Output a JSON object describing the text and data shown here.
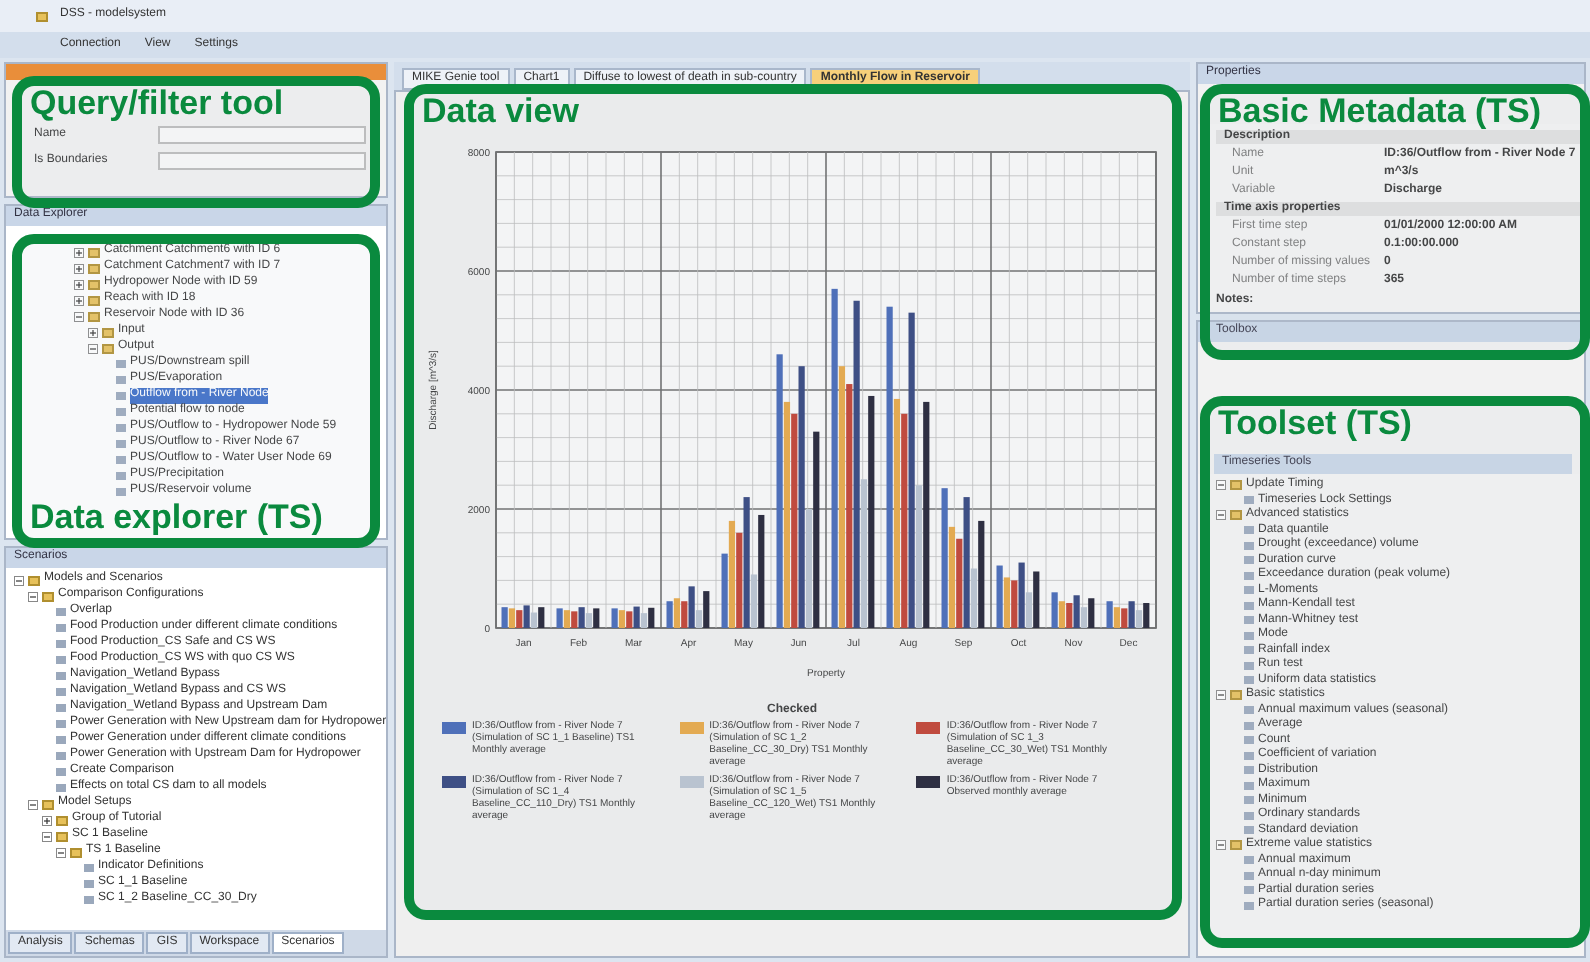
{
  "window": {
    "title": "DSS - modelsystem"
  },
  "menu": [
    "Connection",
    "View",
    "Settings"
  ],
  "query": {
    "fields": [
      {
        "label": "Name"
      },
      {
        "label": "Is Boundaries"
      }
    ]
  },
  "explorer": {
    "header": "Data Explorer",
    "tree": [
      {
        "label": "Catchment Catchment6 with ID 6",
        "expanded": false
      },
      {
        "label": "Catchment Catchment7 with ID 7",
        "expanded": false
      },
      {
        "label": "Hydropower Node with ID 59",
        "expanded": false
      },
      {
        "label": "Reach with ID 18",
        "expanded": false
      },
      {
        "label": "Reservoir Node with ID 36",
        "expanded": true,
        "children": [
          {
            "label": "Input",
            "expanded": false
          },
          {
            "label": "Output",
            "expanded": true,
            "children": [
              {
                "label": "PUS/Downstream spill",
                "selected": false
              },
              {
                "label": "PUS/Evaporation",
                "selected": false
              },
              {
                "label": "Outflow from - River Node",
                "selected": true
              },
              {
                "label": "Potential flow to node",
                "selected": false
              },
              {
                "label": "PUS/Outflow to - Hydropower Node 59",
                "selected": false
              },
              {
                "label": "PUS/Outflow to - River Node 67",
                "selected": false
              },
              {
                "label": "PUS/Outflow to - Water User Node 69",
                "selected": false
              },
              {
                "label": "PUS/Precipitation",
                "selected": false
              },
              {
                "label": "PUS/Reservoir volume",
                "selected": false
              }
            ]
          }
        ]
      }
    ]
  },
  "scenarios": {
    "header": "Scenarios",
    "tree": [
      {
        "label": "Models and Scenarios",
        "expanded": true,
        "children": [
          {
            "label": "Comparison Configurations",
            "expanded": true,
            "children": [
              {
                "label": "Overlap"
              },
              {
                "label": "Food Production under different climate conditions"
              },
              {
                "label": "Food Production_CS Safe and CS WS"
              },
              {
                "label": "Food Production_CS WS with quo CS WS"
              },
              {
                "label": "Navigation_Wetland Bypass"
              },
              {
                "label": "Navigation_Wetland Bypass and CS WS"
              },
              {
                "label": "Navigation_Wetland Bypass and Upstream Dam"
              },
              {
                "label": "Power Generation with New Upstream dam for Hydropower"
              },
              {
                "label": "Power Generation under different climate conditions"
              },
              {
                "label": "Power Generation with Upstream Dam for Hydropower"
              },
              {
                "label": "Create Comparison"
              },
              {
                "label": "Effects on total CS dam to all models"
              }
            ]
          },
          {
            "label": "Model Setups",
            "expanded": true,
            "children": [
              {
                "label": "Group of Tutorial",
                "expanded": false
              },
              {
                "label": "SC 1 Baseline",
                "expanded": true,
                "children": [
                  {
                    "label": "TS 1 Baseline",
                    "expanded": true,
                    "children": [
                      {
                        "label": "Indicator Definitions"
                      },
                      {
                        "label": "SC 1_1 Baseline"
                      },
                      {
                        "label": "SC 1_2 Baseline_CC_30_Dry"
                      }
                    ]
                  }
                ]
              }
            ]
          }
        ]
      }
    ],
    "tabs": [
      {
        "label": "Analysis",
        "selected": false
      },
      {
        "label": "Schemas",
        "selected": false
      },
      {
        "label": "GIS",
        "selected": false
      },
      {
        "label": "Workspace",
        "selected": false
      },
      {
        "label": "Scenarios",
        "selected": true
      }
    ]
  },
  "documents": [
    {
      "label": "MIKE Genie tool",
      "selected": false
    },
    {
      "label": "Chart1",
      "selected": false
    },
    {
      "label": "Diffuse to lowest of death in sub-country",
      "selected": false
    },
    {
      "label": "Monthly Flow in Reservoir",
      "selected": true
    }
  ],
  "chart": {
    "legend_title": "Checked",
    "chart_data": {
      "type": "bar",
      "grid": true,
      "xlabel": "Property",
      "ylabel": "Discharge [m^3/s]",
      "categories": [
        "Jan",
        "Feb",
        "Mar",
        "Apr",
        "May",
        "Jun",
        "Jul",
        "Aug",
        "Sep",
        "Oct",
        "Nov",
        "Dec"
      ],
      "ylim": [
        0,
        8000
      ],
      "yticks": [
        0,
        2000,
        4000,
        6000,
        8000
      ],
      "series": [
        {
          "name": "ID:36/Outflow from - River Node 7 (Simulation of SC 1_1 Baseline) TS1 Monthly average",
          "color": "#3f63b5",
          "values": [
            350,
            330,
            330,
            450,
            1250,
            4600,
            5700,
            5400,
            2350,
            1050,
            600,
            450
          ]
        },
        {
          "name": "ID:36/Outflow from - River Node 7 (Simulation of SC 1_2 Baseline_CC_30_Dry) TS1 Monthly average",
          "color": "#e8a640",
          "values": [
            330,
            300,
            300,
            500,
            1800,
            3800,
            4400,
            3850,
            1700,
            850,
            450,
            350
          ]
        },
        {
          "name": "ID:36/Outflow from - River Node 7 (Simulation of SC 1_3 Baseline_CC_30_Wet) TS1 Monthly average",
          "color": "#c0392b",
          "values": [
            300,
            280,
            280,
            450,
            1600,
            3600,
            4100,
            3600,
            1500,
            800,
            420,
            330
          ]
        },
        {
          "name": "ID:36/Outflow from - River Node 7 (Simulation of SC 1_4 Baseline_CC_110_Dry) TS1 Monthly average",
          "color": "#2c3e7a",
          "values": [
            380,
            350,
            360,
            700,
            2200,
            4400,
            5500,
            5300,
            2200,
            1100,
            550,
            450
          ]
        },
        {
          "name": "ID:36/Outflow from - River Node 7 (Simulation of SC 1_5 Baseline_CC_120_Wet) TS1 Monthly average",
          "color": "#b8c2d0",
          "values": [
            260,
            250,
            250,
            300,
            900,
            2000,
            2500,
            2400,
            1000,
            600,
            350,
            300
          ]
        },
        {
          "name": "ID:36/Outflow from - River Node 7 Observed monthly average",
          "color": "#1a1a2e",
          "values": [
            350,
            330,
            340,
            620,
            1900,
            3300,
            3900,
            3800,
            1800,
            950,
            500,
            420
          ]
        }
      ]
    }
  },
  "properties": {
    "header": "Properties",
    "rows": [
      {
        "kind": "category",
        "name": "Description"
      },
      {
        "kind": "property",
        "name": "Name",
        "value": "ID:36/Outflow from - River Node 7"
      },
      {
        "kind": "property",
        "name": "Unit",
        "value": "m^3/s"
      },
      {
        "kind": "property",
        "name": "Variable",
        "value": "Discharge"
      },
      {
        "kind": "category",
        "name": "Time axis properties"
      },
      {
        "kind": "property",
        "name": "First time step",
        "value": "01/01/2000 12:00:00 AM"
      },
      {
        "kind": "property",
        "name": "Constant step",
        "value": "0.1:00:00.000"
      },
      {
        "kind": "property",
        "name": "Number of missing values",
        "value": "0"
      },
      {
        "kind": "property",
        "name": "Number of time steps",
        "value": "365"
      }
    ],
    "notes": "Notes:"
  },
  "toolset": {
    "header": "Toolbox",
    "subheader": "Timeseries Tools",
    "tree": [
      {
        "label": "Update Timing",
        "expanded": true,
        "children": [
          {
            "label": "Timeseries Lock Settings"
          }
        ]
      },
      {
        "label": "Advanced statistics",
        "expanded": true,
        "children": [
          {
            "label": "Data quantile"
          },
          {
            "label": "Drought (exceedance) volume"
          },
          {
            "label": "Duration curve"
          },
          {
            "label": "Exceedance duration (peak volume)"
          },
          {
            "label": "L-Moments"
          },
          {
            "label": "Mann-Kendall test"
          },
          {
            "label": "Mann-Whitney test"
          },
          {
            "label": "Mode"
          },
          {
            "label": "Rainfall index"
          },
          {
            "label": "Run test"
          },
          {
            "label": "Uniform data statistics"
          }
        ]
      },
      {
        "label": "Basic statistics",
        "expanded": true,
        "children": [
          {
            "label": "Annual maximum values (seasonal)"
          },
          {
            "label": "Average"
          },
          {
            "label": "Count"
          },
          {
            "label": "Coefficient of variation"
          },
          {
            "label": "Distribution"
          },
          {
            "label": "Maximum"
          },
          {
            "label": "Minimum"
          },
          {
            "label": "Ordinary standards"
          },
          {
            "label": "Standard deviation"
          }
        ]
      },
      {
        "label": "Extreme value statistics",
        "expanded": true,
        "children": [
          {
            "label": "Annual maximum"
          },
          {
            "label": "Annual n-day minimum"
          },
          {
            "label": "Partial duration series"
          },
          {
            "label": "Partial duration series (seasonal)"
          }
        ]
      }
    ]
  },
  "annotations": [
    {
      "label": "Query/filter tool"
    },
    {
      "label": "Data explorer (TS)"
    },
    {
      "label": "Data view"
    },
    {
      "label": "Basic Metadata (TS)"
    },
    {
      "label": "Toolset (TS)"
    }
  ]
}
